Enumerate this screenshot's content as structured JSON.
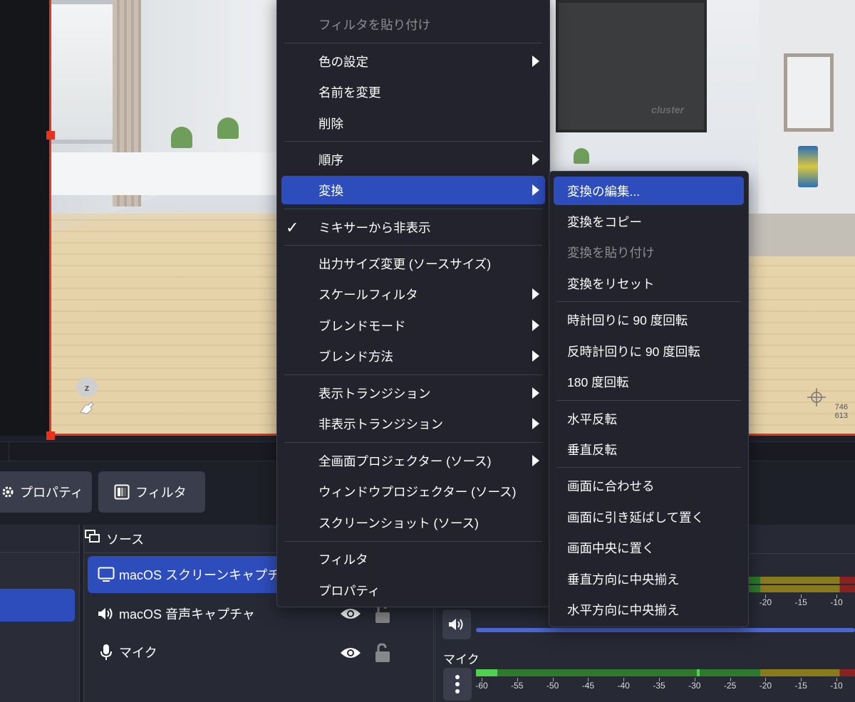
{
  "preview": {
    "tv_logo": "cluster",
    "z_key": "z",
    "coords": [
      "746",
      "613"
    ]
  },
  "toolbar": {
    "properties_label": "プロパティ",
    "filters_label": "フィルタ"
  },
  "sources": {
    "title": "ソース",
    "items": [
      {
        "label": "macOS スクリーンキャプチャ",
        "icon": "monitor-icon"
      },
      {
        "label": "macOS 音声キャプチャ",
        "icon": "speaker-icon"
      },
      {
        "label": "マイク",
        "icon": "microphone-icon"
      }
    ]
  },
  "mixer": {
    "mic_label": "マイク",
    "scale": [
      "-60",
      "-55",
      "-50",
      "-45",
      "-40",
      "-35",
      "-30",
      "-25",
      "-20",
      "-15",
      "-10"
    ]
  },
  "context_menu": {
    "items": [
      {
        "label": "フィルタを貼り付け",
        "disabled": true
      },
      {
        "label": "色の設定",
        "submenu": true
      },
      {
        "label": "名前を変更"
      },
      {
        "label": "削除"
      },
      {
        "label": "順序",
        "submenu": true
      },
      {
        "label": "変換",
        "submenu": true,
        "highlighted": true
      },
      {
        "label": "ミキサーから非表示",
        "checked": true
      },
      {
        "label": "出力サイズ変更 (ソースサイズ)"
      },
      {
        "label": "スケールフィルタ",
        "submenu": true
      },
      {
        "label": "ブレンドモード",
        "submenu": true
      },
      {
        "label": "ブレンド方法",
        "submenu": true
      },
      {
        "label": "表示トランジション",
        "submenu": true
      },
      {
        "label": "非表示トランジション",
        "submenu": true
      },
      {
        "label": "全画面プロジェクター (ソース)",
        "submenu": true
      },
      {
        "label": "ウィンドウプロジェクター (ソース)"
      },
      {
        "label": "スクリーンショット (ソース)"
      },
      {
        "label": "フィルタ"
      },
      {
        "label": "プロパティ"
      }
    ]
  },
  "transform_submenu": {
    "items": [
      {
        "label": "変換の編集...",
        "highlighted": true
      },
      {
        "label": "変換をコピー"
      },
      {
        "label": "変換を貼り付け",
        "disabled": true
      },
      {
        "label": "変換をリセット"
      },
      {
        "label": "時計回りに 90 度回転"
      },
      {
        "label": "反時計回りに 90 度回転"
      },
      {
        "label": "180 度回転"
      },
      {
        "label": "水平反転"
      },
      {
        "label": "垂直反転"
      },
      {
        "label": "画面に合わせる"
      },
      {
        "label": "画面に引き延ばして置く"
      },
      {
        "label": "画面中央に置く"
      },
      {
        "label": "垂直方向に中央揃え"
      },
      {
        "label": "水平方向に中央揃え"
      }
    ]
  },
  "colors": {
    "accent": "#2e4dbd",
    "selection_border": "#e5331f",
    "menu_bg": "#22232c"
  }
}
